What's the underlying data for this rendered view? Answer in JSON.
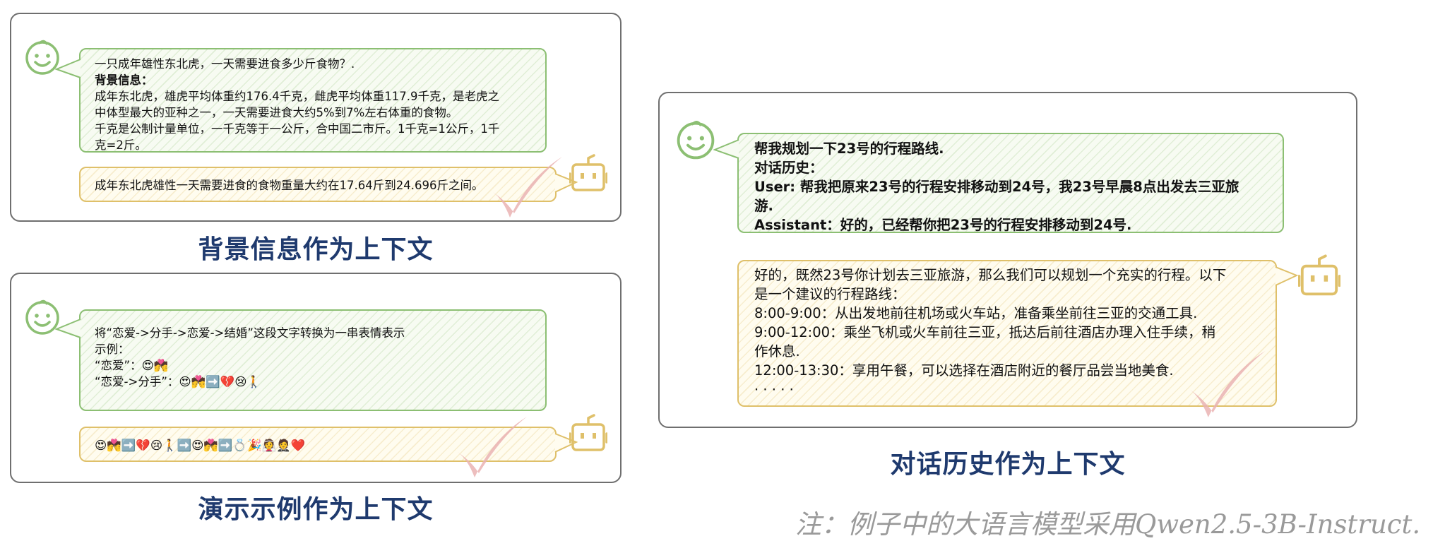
{
  "panel_background": {
    "title": "背景信息作为上下文",
    "user_lines": [
      "一只成年雄性东北虎，一天需要进食多少斤食物？.",
      "背景信息：",
      "成年东北虎，雄虎平均体重约176.4千克，雌虎平均体重117.9千克，是老虎之",
      "中体型最大的亚种之一，一天需要进食大约5%到7%左右体重的食物。",
      "千克是公制计量单位，一千克等于一公斤，合中国二市斤。1千克=1公斤，1千",
      "克=2斤。"
    ],
    "bot_text": "成年东北虎雄性一天需要进食的食物重量大约在17.64斤到24.696斤之间。"
  },
  "panel_demo": {
    "title": "演示示例作为上下文",
    "user_lines": [
      "将“恋爱->分手->恋爱->结婚”这段文字转换为一串表情表示",
      "示例：",
      "“恋爱”：😍💏",
      "“恋爱->分手”：😍💏➡️💔😢🚶"
    ],
    "bot_text": "😍💏➡️💔😢🚶➡️😍💏➡️💍🎉👰🤵❤️"
  },
  "panel_dialog": {
    "title": "对话历史作为上下文",
    "user_lines": [
      "帮我规划一下23号的行程路线.",
      "对话历史：",
      "User: 帮我把原来23号的行程安排移动到24号，我23号早晨8点出发去三亚旅",
      "游.",
      "Assistant：好的，已经帮你把23号的行程安排移动到24号."
    ],
    "bot_lines": [
      "好的，既然23号你计划去三亚旅游，那么我们可以规划一个充实的行程。以下",
      "是一个建议的行程路线：",
      "8:00-9:00：从出发地前往机场或火车站，准备乘坐前往三亚的交通工具.",
      "9:00-12:00：乘坐飞机或火车前往三亚，抵达后前往酒店办理入住手续，稍",
      "作休息.",
      "12:00-13:30：享用午餐，可以选择在酒店附近的餐厅品尝当地美食.",
      "· · · · ·"
    ]
  },
  "note": "注：例子中的大语言模型采用Qwen2.5-3B-Instruct.",
  "colors": {
    "user_border": "#8cbf73",
    "bot_border": "#dfc06a",
    "check": "#eab3b3",
    "title": "#1f3a6e",
    "note": "#9a9a9a"
  },
  "icons": {
    "user": "smiley-face-icon",
    "bot": "robot-icon",
    "check": "checkmark-icon"
  }
}
